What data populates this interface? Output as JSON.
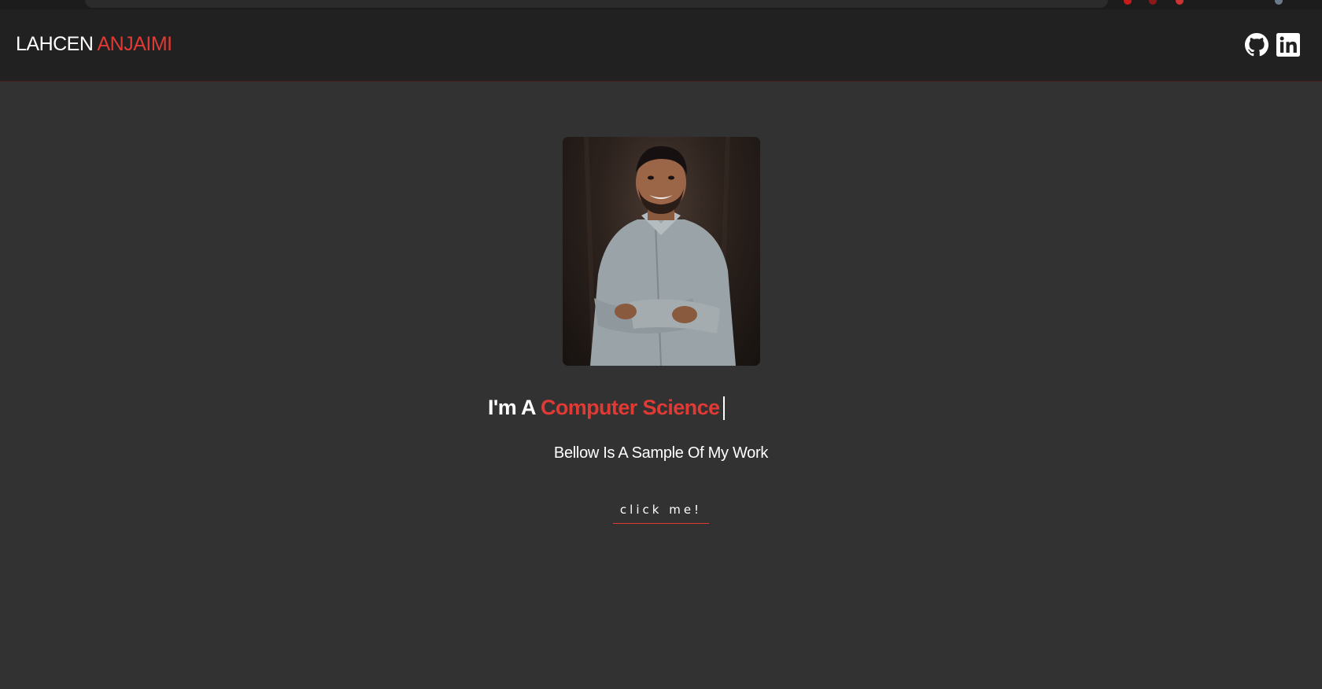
{
  "header": {
    "brand_first": "LAHCEN",
    "brand_last": "ANJAIMI",
    "social_icons": [
      "github-icon",
      "linkedin-icon"
    ]
  },
  "hero": {
    "headline_lead": "I'm A",
    "headline_role": "Computer Science",
    "subtitle": "Bellow Is A Sample Of My Work",
    "cta_label": "click me!"
  },
  "colors": {
    "accent": "#e03a35",
    "background": "#323232",
    "header_background": "#212121"
  }
}
